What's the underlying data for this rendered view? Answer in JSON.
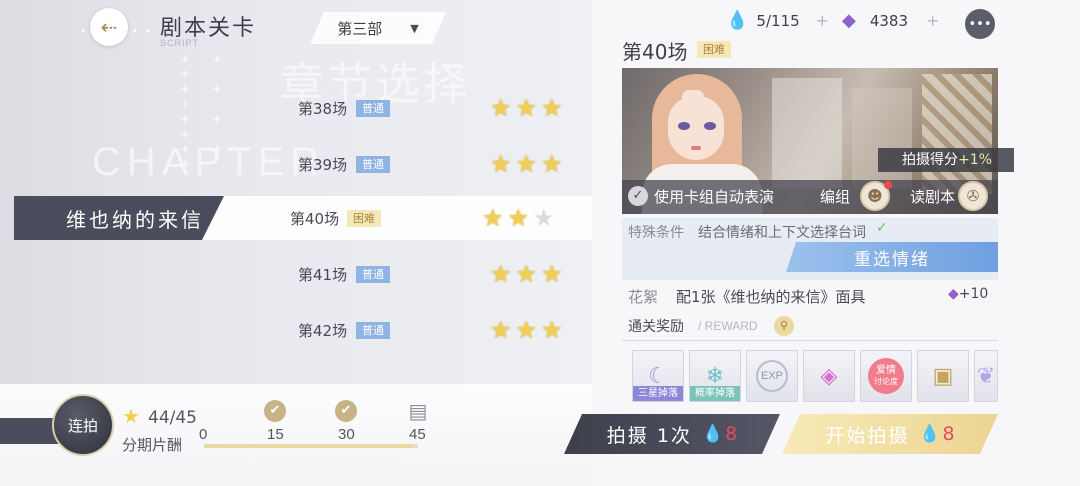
{
  "header": {
    "title": "剧本关卡",
    "subtitle": "SCRIPT",
    "back_icon": "arrow-left-icon",
    "part_select": {
      "value": "第三部",
      "arrow_icon": "triangle-down-icon"
    }
  },
  "background": {
    "word_cn": "章节选择",
    "word_en": "CHAPTER"
  },
  "stages": [
    {
      "name": "第38场",
      "tag": "普通",
      "stars": 3
    },
    {
      "name": "第39场",
      "tag": "普通",
      "stars": 3
    },
    {
      "name": "第40场",
      "tag": "困难",
      "stars": 2,
      "active": true,
      "chapter_title": "维也纳的来信"
    },
    {
      "name": "第41场",
      "tag": "普通",
      "stars": 3
    },
    {
      "name": "第42场",
      "tag": "普通",
      "stars": 3
    }
  ],
  "bottom": {
    "combo_label": "连拍",
    "star_count": "44/45",
    "reward_label": "分期片酬",
    "progress_fraction": 0.978,
    "milestones": [
      "0",
      "15",
      "30",
      "45"
    ]
  },
  "resources": {
    "water": {
      "value": "5/115",
      "icon": "water-drop-icon"
    },
    "gem": {
      "value": "4383",
      "icon": "purple-crystal-icon"
    },
    "plus": "+"
  },
  "scene": {
    "title": "第40场",
    "tag": "困难",
    "bonus_label": "拍摄得分",
    "bonus_value": "+1%",
    "auto_label": "使用卡组自动表演",
    "deck_label": "编组",
    "script_label": "读剧本",
    "condition_label": "特殊条件",
    "condition_text": "结合情绪和上下文选择台词",
    "reselect_label": "重选情绪",
    "flower_label": "花絮",
    "flower_text": "配1张《维也纳的来信》面具",
    "flower_bonus": "+10",
    "reward_title": "通关奖励",
    "reward_en": "/ REWARD"
  },
  "rewards": [
    {
      "icon": "moon-charm-icon",
      "tag": "三星掉落",
      "tag_color": "#8e86d8"
    },
    {
      "icon": "crystal-pendant-icon",
      "tag": "概率掉落",
      "tag_color": "#7cc4b8"
    },
    {
      "icon": "exp-orb-icon",
      "tag": ""
    },
    {
      "icon": "pink-gem-icon",
      "tag": ""
    },
    {
      "icon": "love-discussion-icon",
      "tag": ""
    },
    {
      "icon": "gold-chest-icon",
      "tag": ""
    },
    {
      "icon": "wing-icon",
      "tag": ""
    }
  ],
  "reward_text": {
    "love": "爱情",
    "discuss": "讨论度",
    "exp": "EXP"
  },
  "actions": {
    "shoot_once": {
      "label": "拍摄 1次",
      "cost": "8"
    },
    "start_shoot": {
      "label": "开始拍摄",
      "cost": "8"
    }
  },
  "colors": {
    "accent_gold": "#ecd594",
    "dark": "#4b4d5c",
    "tag_blue": "#8fb3e3",
    "cost_red": "#e24b57"
  }
}
